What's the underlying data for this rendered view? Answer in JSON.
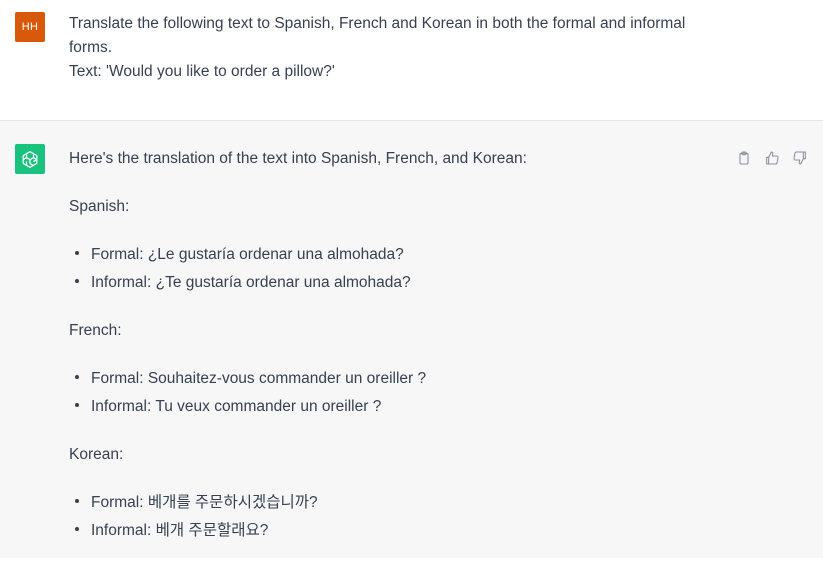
{
  "user_message": {
    "avatar_initials": "HH",
    "line1": "Translate the following text to Spanish, French and Korean in both the formal and informal",
    "line2": "forms.",
    "line3": "Text: 'Would you like to order a pillow?'"
  },
  "assistant_message": {
    "intro": "Here's the translation of the text into Spanish, French, and Korean:",
    "sections": [
      {
        "heading": "Spanish:",
        "items": [
          "Formal: ¿Le gustaría ordenar una almohada?",
          "Informal: ¿Te gustaría ordenar una almohada?"
        ]
      },
      {
        "heading": "French:",
        "items": [
          "Formal: Souhaitez-vous commander un oreiller ?",
          "Informal: Tu veux commander un oreiller ?"
        ]
      },
      {
        "heading": "Korean:",
        "items": [
          "Formal: 베개를 주문하시겠습니까?",
          "Informal: 베개 주문할래요?"
        ]
      }
    ]
  },
  "icons": {
    "copy": "clipboard-icon",
    "thumbs_up": "thumbs-up-icon",
    "thumbs_down": "thumbs-down-icon"
  },
  "colors": {
    "user_avatar_bg": "#d9590b",
    "assistant_avatar_bg": "#19c37d",
    "assistant_row_bg": "#f7f7f8"
  }
}
